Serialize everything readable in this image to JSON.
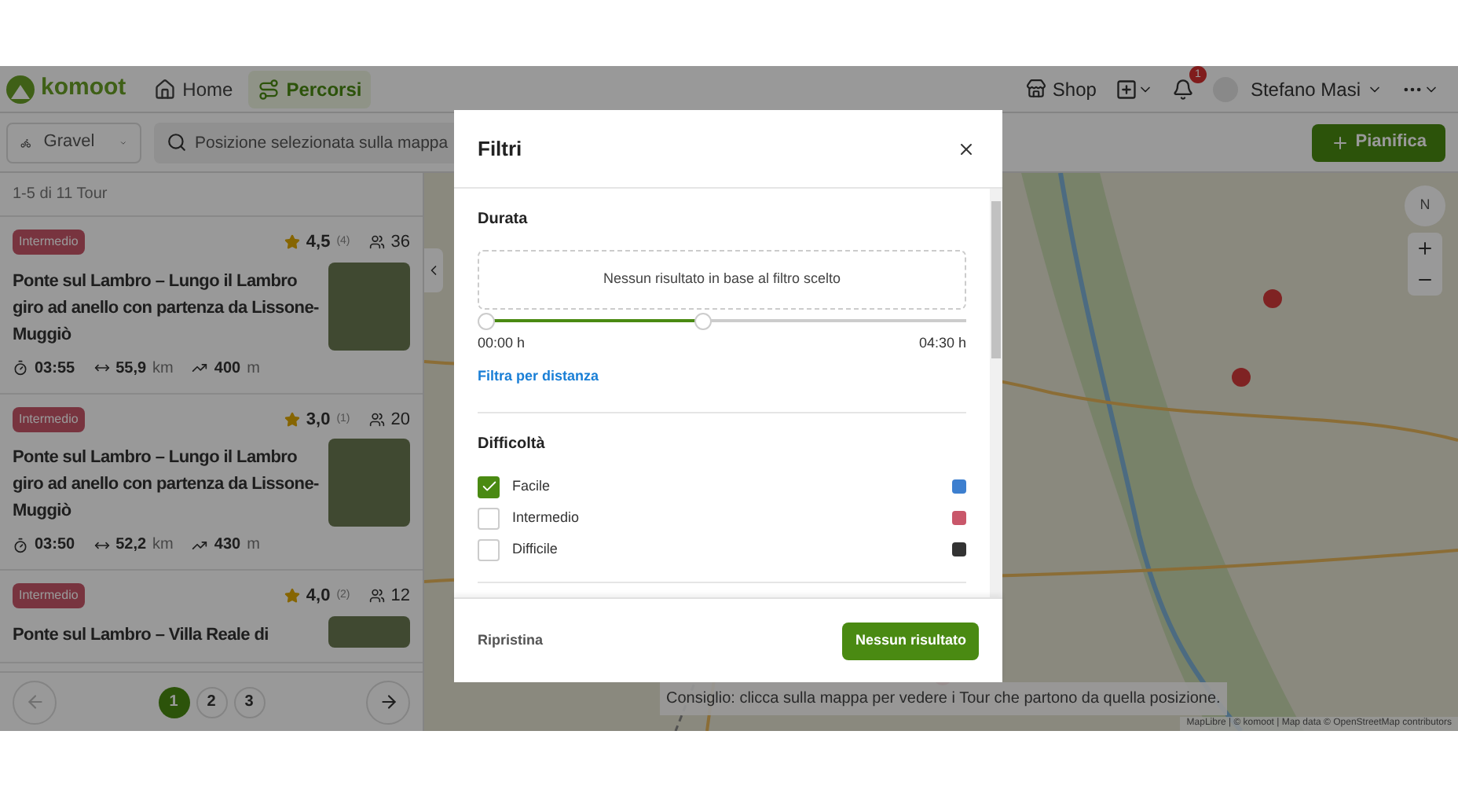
{
  "header": {
    "logo": "komoot",
    "nav": [
      {
        "label": "Home",
        "selected": false
      },
      {
        "label": "Percorsi",
        "selected": true
      }
    ],
    "shop": "Shop",
    "notification_count": "1",
    "user": "Stefano Masi"
  },
  "toolbar": {
    "sport": "Gravel",
    "search": {
      "placeholder": "Posizione selezionata sulla mappa"
    },
    "plan_button": "Pianifica"
  },
  "tour_list": {
    "count": "1-5 di 11 Tour",
    "tours": [
      {
        "difficulty": "Intermedio",
        "rating": "4,5",
        "reviews": "(4)",
        "members": "36",
        "title": "Ponte sul Lambro – Lungo il Lambro giro ad anello con partenza da Lissone-Muggiò",
        "duration": "03:55",
        "distance": "55,9",
        "distance_unit": "km",
        "elevation": "400",
        "elevation_unit": "m"
      },
      {
        "difficulty": "Intermedio",
        "rating": "3,0",
        "reviews": "(1)",
        "members": "20",
        "title": "Ponte sul Lambro – Lungo il Lambro giro ad anello con partenza da Lissone-Muggiò",
        "duration": "03:50",
        "distance": "52,2",
        "distance_unit": "km",
        "elevation": "430",
        "elevation_unit": "m"
      },
      {
        "difficulty": "Intermedio",
        "rating": "4,0",
        "reviews": "(2)",
        "members": "12",
        "title": "Ponte sul Lambro – Villa Reale di"
      }
    ],
    "pages": [
      {
        "label": "1",
        "selected": true
      },
      {
        "label": "2",
        "selected": false
      },
      {
        "label": "3",
        "selected": false
      }
    ]
  },
  "map": {
    "compass": "N",
    "tip": "Consiglio: clicca sulla mappa per vedere i Tour che partono da quella posizione.",
    "attribution": "MapLibre | © komoot | Map data © OpenStreetMap contributors"
  },
  "modal": {
    "title": "Filtri",
    "duration": {
      "title": "Durata",
      "empty_message": "Nessun risultato in base al filtro scelto",
      "level": 0.45,
      "min_label": "00:00 h",
      "max_label": "04:30 h",
      "link": "Filtra per distanza"
    },
    "difficulty": {
      "title": "Difficoltà",
      "options": [
        {
          "label": "Facile",
          "checked": true,
          "color": "#3d7fcf"
        },
        {
          "label": "Intermedio",
          "checked": false,
          "color": "#c9576a"
        },
        {
          "label": "Difficile",
          "checked": false,
          "color": "#333333"
        }
      ]
    },
    "reset": "Ripristina",
    "submit": "Nessun risultato"
  }
}
